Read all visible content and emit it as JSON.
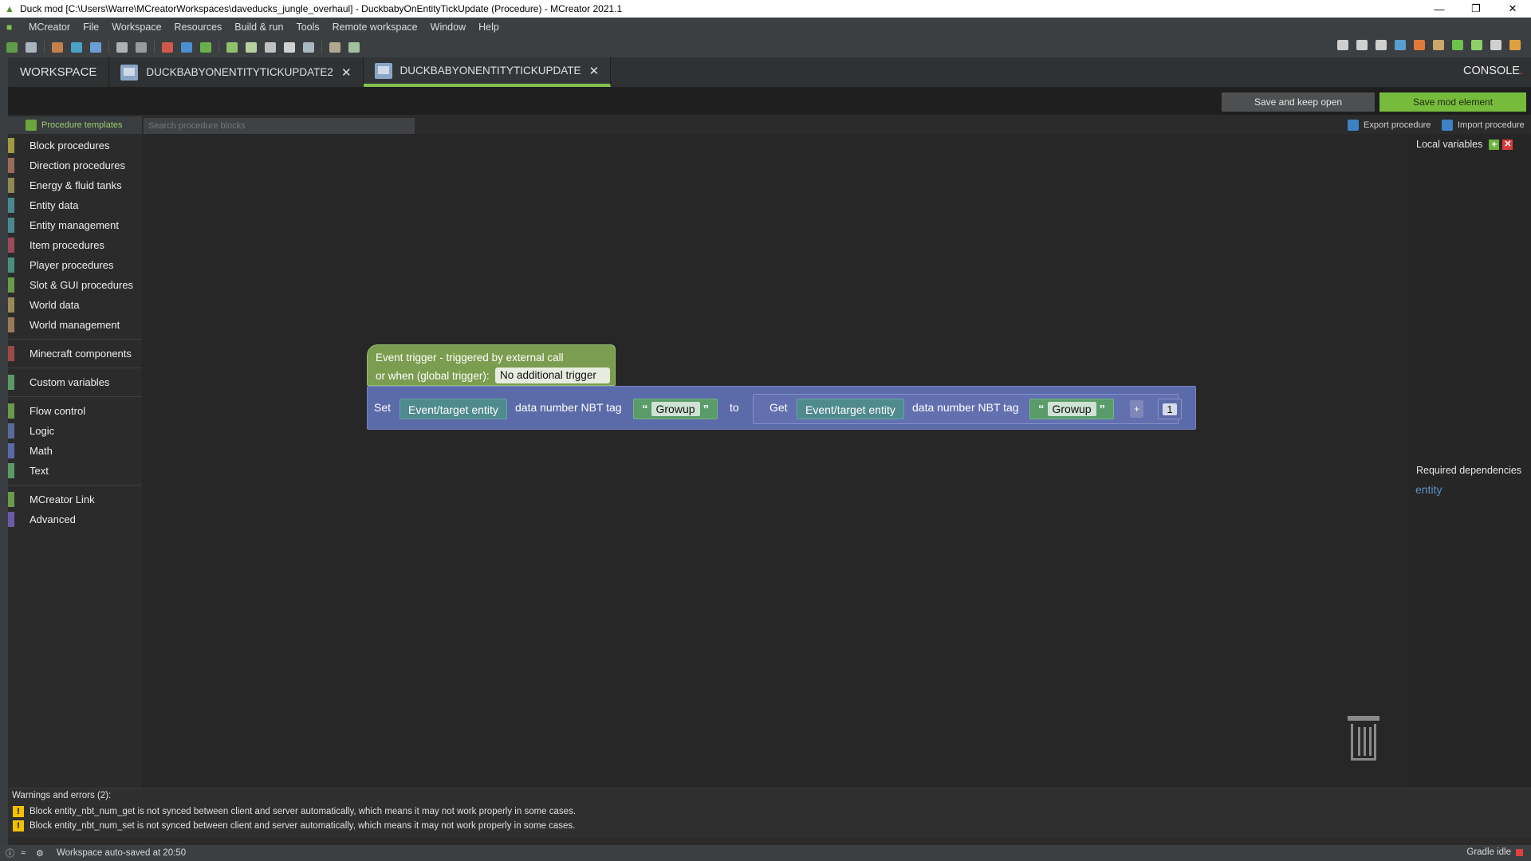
{
  "window": {
    "title": "Duck mod [C:\\Users\\Warre\\MCreatorWorkspaces\\daveducks_jungle_overhaul] - DuckbabyOnEntityTickUpdate (Procedure) - MCreator 2021.1",
    "minimize": "—",
    "restore": "❐",
    "close": "✕"
  },
  "menu": [
    "MCreator",
    "File",
    "Workspace",
    "Resources",
    "Build & run",
    "Tools",
    "Remote workspace",
    "Window",
    "Help"
  ],
  "tabs": {
    "workspace": "WORKSPACE",
    "tab1": "DUCKBABYONENTITYTICKUPDATE2",
    "tab2": "DUCKBABYONENTITYTICKUPDATE",
    "close_glyph": "✕",
    "console": "CONSOLE",
    "console_dot": "."
  },
  "actions": {
    "save_keep_open": "Save and keep open",
    "save_mod_element": "Save mod element"
  },
  "procedure_bar": {
    "templates": "Procedure templates",
    "search_placeholder": "Search procedure blocks",
    "export": "Export procedure",
    "import": "Import procedure"
  },
  "categories": [
    {
      "label": "Block procedures",
      "color": "#a19a42"
    },
    {
      "label": "Direction procedures",
      "color": "#9a6b5b"
    },
    {
      "label": "Energy & fluid tanks",
      "color": "#8e8a52"
    },
    {
      "label": "Entity data",
      "color": "#4a8a8f"
    },
    {
      "label": "Entity management",
      "color": "#4a8a8f"
    },
    {
      "label": "Item procedures",
      "color": "#9a4a5a"
    },
    {
      "label": "Player procedures",
      "color": "#4a8f7a"
    },
    {
      "label": "Slot & GUI procedures",
      "color": "#6a9a4a"
    },
    {
      "label": "World data",
      "color": "#9a8a5a"
    },
    {
      "label": "World management",
      "color": "#9a7a5a"
    },
    {
      "label": "Minecraft components",
      "color": "#9a4a4a"
    },
    {
      "label": "Custom variables",
      "color": "#5a9a6a"
    },
    {
      "label": "Flow control",
      "color": "#6a9a4a"
    },
    {
      "label": "Logic",
      "color": "#5a6a9a"
    },
    {
      "label": "Math",
      "color": "#5a6aa8"
    },
    {
      "label": "Text",
      "color": "#5a9a6a"
    },
    {
      "label": "MCreator Link",
      "color": "#6a9a4a"
    },
    {
      "label": "Advanced",
      "color": "#6a5aa8"
    }
  ],
  "side": {
    "local_variables": "Local variables",
    "add_glyph": "+",
    "remove_glyph": "✕",
    "required_dependencies": "Required dependencies",
    "dependency": "entity"
  },
  "blocks": {
    "trigger_line1": "Event trigger - triggered by external call",
    "trigger_line2": "or when (global trigger):",
    "trigger_value": "No additional trigger",
    "set": "Set",
    "entity1": "Event/target entity",
    "nbt_label1": "data number NBT tag",
    "open_quote": "“",
    "close_quote": "”",
    "string1": "Growup",
    "to": "to",
    "get": "Get",
    "entity2": "Event/target entity",
    "nbt_label2": "data number NBT tag",
    "string2": "Growup",
    "operator": "+",
    "number": "1"
  },
  "warnings": {
    "header": "Warnings and errors (2):",
    "icon_glyph": "!",
    "items": [
      "Block entity_nbt_num_get is not synced between client and server automatically, which means it may not work properly in some cases.",
      "Block entity_nbt_num_set is not synced between client and server automatically, which means it may not work properly in some cases."
    ]
  },
  "status": {
    "message": "Workspace auto-saved at 20:50",
    "gradle": "Gradle idle"
  },
  "colors": {
    "accent_green": "#76bb3c",
    "trigger_block": "#7b9d50",
    "math_block": "#5b6aa8",
    "entity_block": "#4f8a8f",
    "text_block": "#5a9b6a",
    "warning": "#f2c200"
  }
}
